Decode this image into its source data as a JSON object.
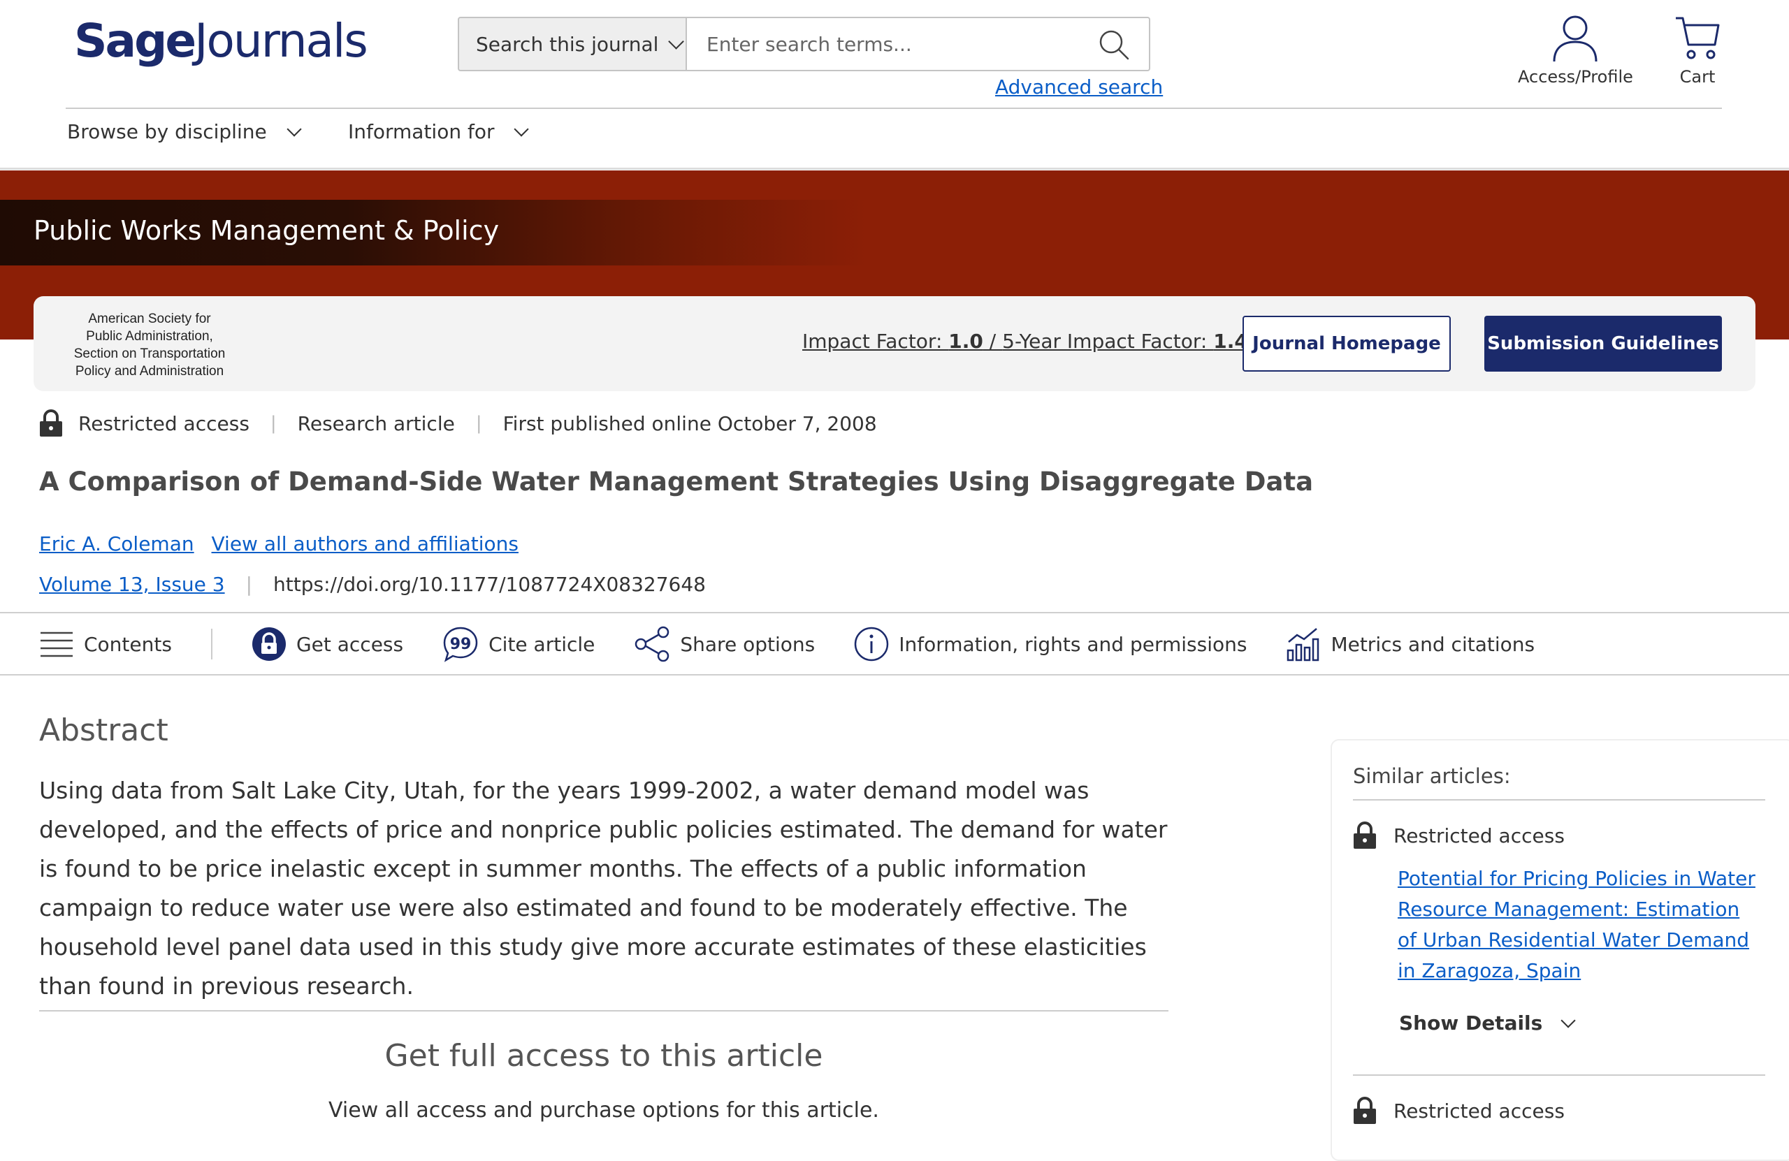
{
  "header": {
    "logo_sage": "Sage",
    "logo_journals": "Journals",
    "search_scope": "Search this journal",
    "search_placeholder": "Enter search terms...",
    "advanced_search": "Advanced search",
    "access_profile": "Access/Profile",
    "cart": "Cart"
  },
  "nav": {
    "browse": "Browse by discipline",
    "information": "Information for"
  },
  "journal": {
    "title": "Public Works Management & Policy",
    "society_lines": [
      "American Society for",
      "Public Administration,",
      "Section on Transportation",
      "Policy and Administration"
    ],
    "impact_label": "Impact Factor: ",
    "impact_value": "1.0",
    "impact_sep": " / ",
    "five_year_label": "5-Year Impact Factor: ",
    "five_year_value": "1.4",
    "homepage_button": "Journal Homepage",
    "submission_button": "Submission Guidelines"
  },
  "article": {
    "access": "Restricted access",
    "type": "Research article",
    "published": "First published online October 7, 2008",
    "title": "A Comparison of Demand-Side Water Management Strategies Using Disaggregate Data",
    "author": "Eric A. Coleman",
    "all_authors": "View all authors and affiliations",
    "volume": "Volume 13, Issue 3",
    "doi": "https://doi.org/10.1177/1087724X08327648"
  },
  "toolbar": {
    "contents": "Contents",
    "get_access": "Get access",
    "cite": "Cite article",
    "share": "Share options",
    "info": "Information, rights and permissions",
    "metrics": "Metrics and citations"
  },
  "abstract": {
    "heading": "Abstract",
    "text": "Using data from Salt Lake City, Utah, for the years 1999-2002, a water demand model was developed, and the effects of price and nonprice public policies estimated. The demand for water is found to be price inelastic except in summer months. The effects of a public information campaign to reduce water use were also estimated and found to be moderately effective. The household level panel data used in this study give more accurate estimates of these elasticities than found in previous research.",
    "access_heading": "Get full access to this article",
    "access_sub": "View all access and purchase options for this article."
  },
  "sidebar": {
    "heading": "Similar articles:",
    "items": [
      {
        "access": "Restricted access",
        "title": "Potential for Pricing Policies in Water Resource Management: Estimation of Urban Residential Water Demand in Zaragoza, Spain",
        "show_details": "Show Details"
      },
      {
        "access": "Restricted access"
      }
    ]
  },
  "colors": {
    "brand_navy": "#1b2a6b",
    "banner_red": "#8c1f06",
    "link_blue": "#0a5dc7"
  }
}
